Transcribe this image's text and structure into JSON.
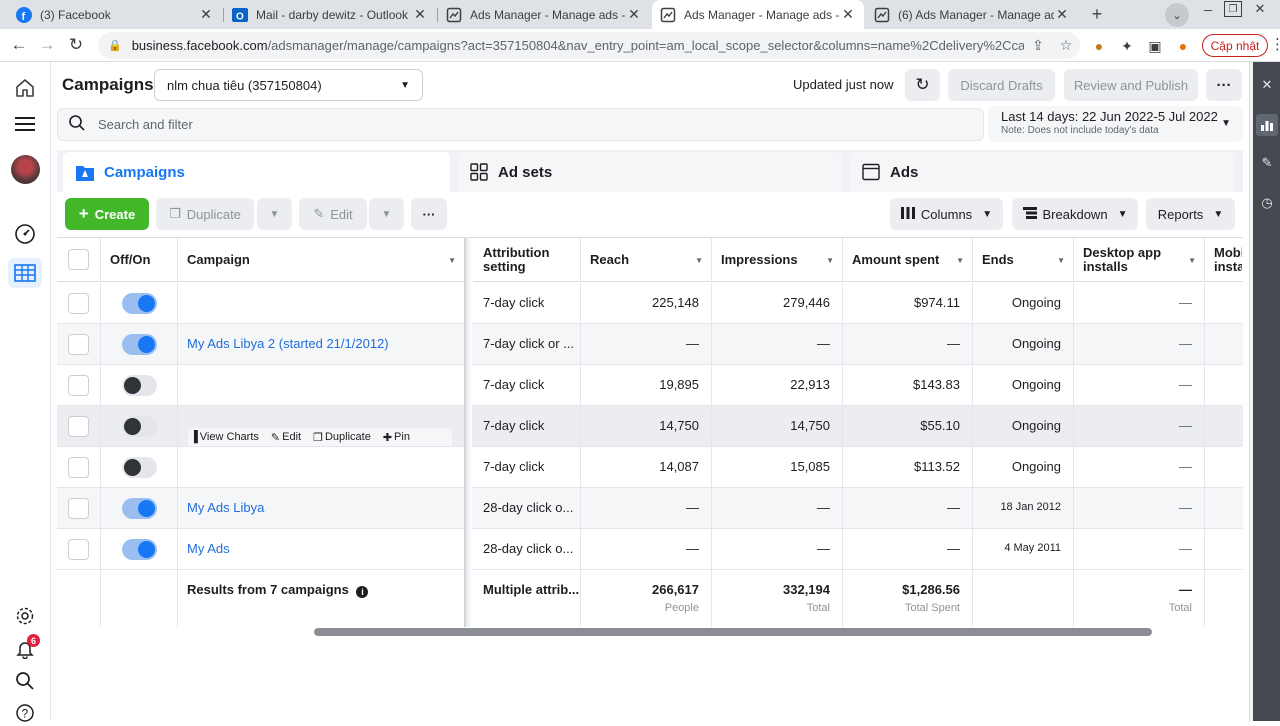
{
  "browser": {
    "tabs": [
      {
        "title": "(3) Facebook",
        "favicon": "facebook-icon",
        "active": false
      },
      {
        "title": "Mail - darby dewitz - Outlook",
        "favicon": "outlook-icon",
        "active": false
      },
      {
        "title": "Ads Manager - Manage ads - Ca",
        "favicon": "ads-manager-icon",
        "active": false
      },
      {
        "title": "Ads Manager - Manage ads - Ca",
        "favicon": "ads-manager-icon",
        "active": true
      },
      {
        "title": "(6) Ads Manager - Manage ads -",
        "favicon": "ads-manager-icon",
        "active": false
      }
    ],
    "url_host": "business.facebook.com",
    "url_path": "/adsmanager/manage/campaigns?act=357150804&nav_entry_point=am_local_scope_selector&columns=name%2Cdelivery%2Ccampai...",
    "update_label": "Cập nhật"
  },
  "header": {
    "title": "Campaigns",
    "account": "nlm chua tiêu (357150804)",
    "updated": "Updated just now",
    "discard_label": "Discard Drafts",
    "review_label": "Review and Publish"
  },
  "search": {
    "placeholder": "Search and filter"
  },
  "date_range": {
    "main": "Last 14 days: 22 Jun 2022-5 Jul 2022",
    "note": "Note: Does not include today's data"
  },
  "level_tabs": {
    "campaigns": "Campaigns",
    "adsets": "Ad sets",
    "ads": "Ads"
  },
  "toolbar": {
    "create": "Create",
    "duplicate": "Duplicate",
    "edit": "Edit",
    "columns": "Columns",
    "breakdown": "Breakdown",
    "reports": "Reports"
  },
  "table": {
    "headers": {
      "offon": "Off/On",
      "campaign": "Campaign",
      "attribution": "Attribution setting",
      "reach": "Reach",
      "impressions": "Impressions",
      "amount": "Amount spent",
      "ends": "Ends",
      "desktop": "Desktop app installs",
      "mobile": "Mobi insta"
    },
    "rows": [
      {
        "on": true,
        "name": "",
        "attribution": "7-day click",
        "reach": "225,148",
        "impressions": "279,446",
        "amount": "$974.11",
        "ends": "Ongoing",
        "desktop": "—"
      },
      {
        "on": true,
        "name": "My Ads Libya 2 (started 21/1/2012)",
        "attribution": "7-day click or ...",
        "reach": "—",
        "impressions": "—",
        "amount": "—",
        "ends": "Ongoing",
        "desktop": "—"
      },
      {
        "on": false,
        "name": "",
        "attribution": "7-day click",
        "reach": "19,895",
        "impressions": "22,913",
        "amount": "$143.83",
        "ends": "Ongoing",
        "desktop": "—"
      },
      {
        "on": false,
        "name": "",
        "attribution": "7-day click",
        "reach": "14,750",
        "impressions": "14,750",
        "amount": "$55.10",
        "ends": "Ongoing",
        "desktop": "—"
      },
      {
        "on": false,
        "name": "",
        "attribution": "7-day click",
        "reach": "14,087",
        "impressions": "15,085",
        "amount": "$113.52",
        "ends": "Ongoing",
        "desktop": "—"
      },
      {
        "on": true,
        "name": "My Ads Libya",
        "attribution": "28-day click o...",
        "reach": "—",
        "impressions": "—",
        "amount": "—",
        "ends": "18 Jan 2012",
        "desktop": "—"
      },
      {
        "on": true,
        "name": "My Ads",
        "attribution": "28-day click o...",
        "reach": "—",
        "impressions": "—",
        "amount": "—",
        "ends": "4 May 2011",
        "desktop": "—"
      }
    ],
    "hover_actions": {
      "view_charts": "View Charts",
      "edit": "Edit",
      "duplicate": "Duplicate",
      "pin": "Pin"
    },
    "summary": {
      "label": "Results from 7 campaigns",
      "attribution": "Multiple attrib...",
      "reach": "266,617",
      "reach_sub": "People",
      "impressions": "332,194",
      "impressions_sub": "Total",
      "amount": "$1,286.56",
      "amount_sub": "Total Spent",
      "desktop": "—",
      "desktop_sub": "Total"
    }
  },
  "notifications": {
    "count": "6"
  },
  "colors": {
    "accent": "#1877f2",
    "create": "#42b72a",
    "link": "#216fdb"
  }
}
